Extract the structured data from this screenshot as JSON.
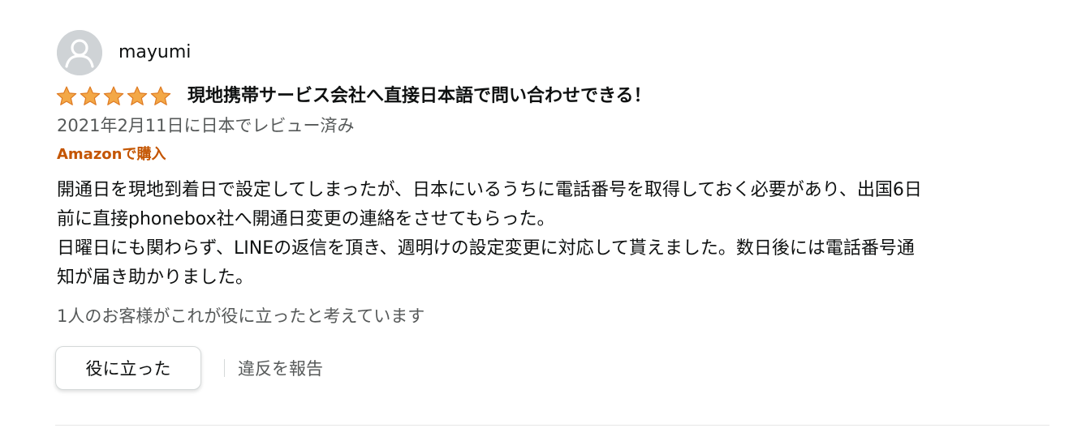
{
  "reviewer": {
    "name": "mayumi",
    "avatar_icon": "default-user-avatar-icon"
  },
  "review": {
    "rating": 5,
    "rating_max": 5,
    "star_color": "#f3a847",
    "title": "現地携帯サービス会社へ直接日本語で問い合わせできる！",
    "date_text": "2021年2月11日に日本でレビュー済み",
    "verified_label": "Amazonで購入",
    "body_lines": [
      "開通日を現地到着日で設定してしまったが、日本にいるうちに電話番号を取得しておく必要があり、出国6日",
      "前に直接phonebox社へ開通日変更の連絡をさせてもらった。",
      "日曜日にも関わらず、LINEの返信を頂き、週明けの設定変更に対応して貰えました。数日後には電話番号通",
      "知が届き助かりました。"
    ],
    "helpful_count_text": "1人のお客様がこれが役に立ったと考えています"
  },
  "actions": {
    "helpful_label": "役に立った",
    "report_label": "違反を報告"
  },
  "colors": {
    "verified": "#c45500",
    "secondary_text": "#565959",
    "primary_text": "#0f1111"
  }
}
